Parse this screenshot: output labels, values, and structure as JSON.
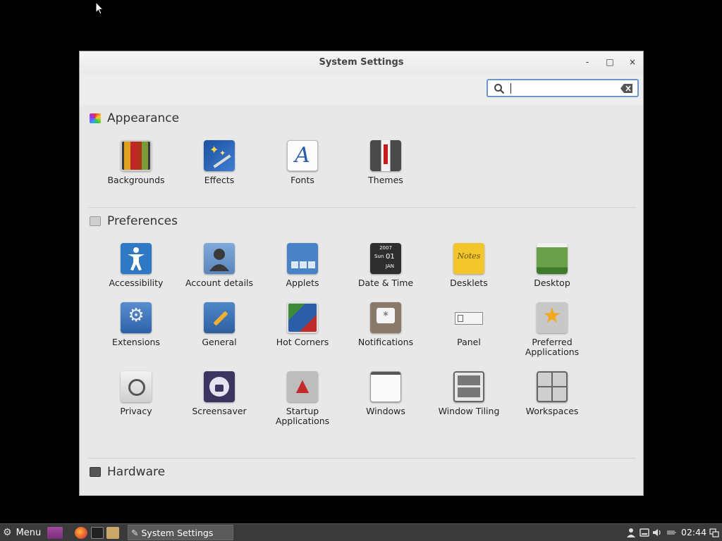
{
  "window": {
    "title": "System Settings",
    "minimize": "-",
    "maximize": "□",
    "close": "×"
  },
  "search": {
    "value": "",
    "placeholder": ""
  },
  "sections": {
    "appearance": {
      "title": "Appearance",
      "items": [
        "Backgrounds",
        "Effects",
        "Fonts",
        "Themes"
      ]
    },
    "preferences": {
      "title": "Preferences",
      "items": [
        "Accessibility",
        "Account details",
        "Applets",
        "Date & Time",
        "Desklets",
        "Desktop",
        "Extensions",
        "General",
        "Hot Corners",
        "Notifications",
        "Panel",
        "Preferred Applications",
        "Privacy",
        "Screensaver",
        "Startup Applications",
        "Windows",
        "Window Tiling",
        "Workspaces"
      ]
    },
    "hardware": {
      "title": "Hardware"
    }
  },
  "icon_texts": {
    "fonts_letter": "A",
    "date_year": "2007",
    "date_day": "Sun",
    "date_num": "01",
    "date_month": "JAN",
    "desklets_note": "Notes"
  },
  "taskbar": {
    "menu_label": "Menu",
    "task_label": "System Settings",
    "clock": "02:44"
  },
  "colors": {
    "accent": "#6b97c9",
    "taskbar": "#3a3a3a"
  }
}
